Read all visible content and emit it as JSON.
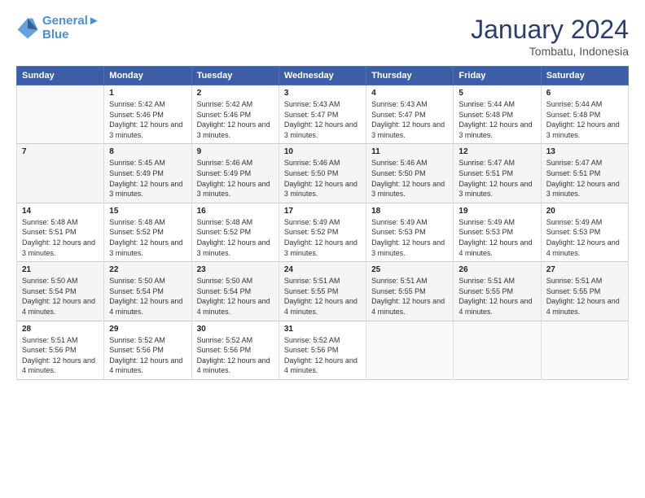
{
  "header": {
    "logo_line1": "General",
    "logo_line2": "Blue",
    "month": "January 2024",
    "location": "Tombatu, Indonesia"
  },
  "weekdays": [
    "Sunday",
    "Monday",
    "Tuesday",
    "Wednesday",
    "Thursday",
    "Friday",
    "Saturday"
  ],
  "weeks": [
    [
      {
        "day": "",
        "info": ""
      },
      {
        "day": "1",
        "info": "Sunrise: 5:42 AM\nSunset: 5:46 PM\nDaylight: 12 hours\nand 3 minutes."
      },
      {
        "day": "2",
        "info": "Sunrise: 5:42 AM\nSunset: 5:46 PM\nDaylight: 12 hours\nand 3 minutes."
      },
      {
        "day": "3",
        "info": "Sunrise: 5:43 AM\nSunset: 5:47 PM\nDaylight: 12 hours\nand 3 minutes."
      },
      {
        "day": "4",
        "info": "Sunrise: 5:43 AM\nSunset: 5:47 PM\nDaylight: 12 hours\nand 3 minutes."
      },
      {
        "day": "5",
        "info": "Sunrise: 5:44 AM\nSunset: 5:48 PM\nDaylight: 12 hours\nand 3 minutes."
      },
      {
        "day": "6",
        "info": "Sunrise: 5:44 AM\nSunset: 5:48 PM\nDaylight: 12 hours\nand 3 minutes."
      }
    ],
    [
      {
        "day": "7",
        "info": ""
      },
      {
        "day": "8",
        "info": "Sunrise: 5:45 AM\nSunset: 5:49 PM\nDaylight: 12 hours\nand 3 minutes."
      },
      {
        "day": "9",
        "info": "Sunrise: 5:46 AM\nSunset: 5:49 PM\nDaylight: 12 hours\nand 3 minutes."
      },
      {
        "day": "10",
        "info": "Sunrise: 5:46 AM\nSunset: 5:50 PM\nDaylight: 12 hours\nand 3 minutes."
      },
      {
        "day": "11",
        "info": "Sunrise: 5:46 AM\nSunset: 5:50 PM\nDaylight: 12 hours\nand 3 minutes."
      },
      {
        "day": "12",
        "info": "Sunrise: 5:47 AM\nSunset: 5:51 PM\nDaylight: 12 hours\nand 3 minutes."
      },
      {
        "day": "13",
        "info": "Sunrise: 5:47 AM\nSunset: 5:51 PM\nDaylight: 12 hours\nand 3 minutes."
      }
    ],
    [
      {
        "day": "14",
        "info": "Sunrise: 5:48 AM\nSunset: 5:51 PM\nDaylight: 12 hours\nand 3 minutes."
      },
      {
        "day": "15",
        "info": "Sunrise: 5:48 AM\nSunset: 5:52 PM\nDaylight: 12 hours\nand 3 minutes."
      },
      {
        "day": "16",
        "info": "Sunrise: 5:48 AM\nSunset: 5:52 PM\nDaylight: 12 hours\nand 3 minutes."
      },
      {
        "day": "17",
        "info": "Sunrise: 5:49 AM\nSunset: 5:52 PM\nDaylight: 12 hours\nand 3 minutes."
      },
      {
        "day": "18",
        "info": "Sunrise: 5:49 AM\nSunset: 5:53 PM\nDaylight: 12 hours\nand 3 minutes."
      },
      {
        "day": "19",
        "info": "Sunrise: 5:49 AM\nSunset: 5:53 PM\nDaylight: 12 hours\nand 4 minutes."
      },
      {
        "day": "20",
        "info": "Sunrise: 5:49 AM\nSunset: 5:53 PM\nDaylight: 12 hours\nand 4 minutes."
      }
    ],
    [
      {
        "day": "21",
        "info": "Sunrise: 5:50 AM\nSunset: 5:54 PM\nDaylight: 12 hours\nand 4 minutes."
      },
      {
        "day": "22",
        "info": "Sunrise: 5:50 AM\nSunset: 5:54 PM\nDaylight: 12 hours\nand 4 minutes."
      },
      {
        "day": "23",
        "info": "Sunrise: 5:50 AM\nSunset: 5:54 PM\nDaylight: 12 hours\nand 4 minutes."
      },
      {
        "day": "24",
        "info": "Sunrise: 5:51 AM\nSunset: 5:55 PM\nDaylight: 12 hours\nand 4 minutes."
      },
      {
        "day": "25",
        "info": "Sunrise: 5:51 AM\nSunset: 5:55 PM\nDaylight: 12 hours\nand 4 minutes."
      },
      {
        "day": "26",
        "info": "Sunrise: 5:51 AM\nSunset: 5:55 PM\nDaylight: 12 hours\nand 4 minutes."
      },
      {
        "day": "27",
        "info": "Sunrise: 5:51 AM\nSunset: 5:55 PM\nDaylight: 12 hours\nand 4 minutes."
      }
    ],
    [
      {
        "day": "28",
        "info": "Sunrise: 5:51 AM\nSunset: 5:56 PM\nDaylight: 12 hours\nand 4 minutes."
      },
      {
        "day": "29",
        "info": "Sunrise: 5:52 AM\nSunset: 5:56 PM\nDaylight: 12 hours\nand 4 minutes."
      },
      {
        "day": "30",
        "info": "Sunrise: 5:52 AM\nSunset: 5:56 PM\nDaylight: 12 hours\nand 4 minutes."
      },
      {
        "day": "31",
        "info": "Sunrise: 5:52 AM\nSunset: 5:56 PM\nDaylight: 12 hours\nand 4 minutes."
      },
      {
        "day": "",
        "info": ""
      },
      {
        "day": "",
        "info": ""
      },
      {
        "day": "",
        "info": ""
      }
    ]
  ]
}
